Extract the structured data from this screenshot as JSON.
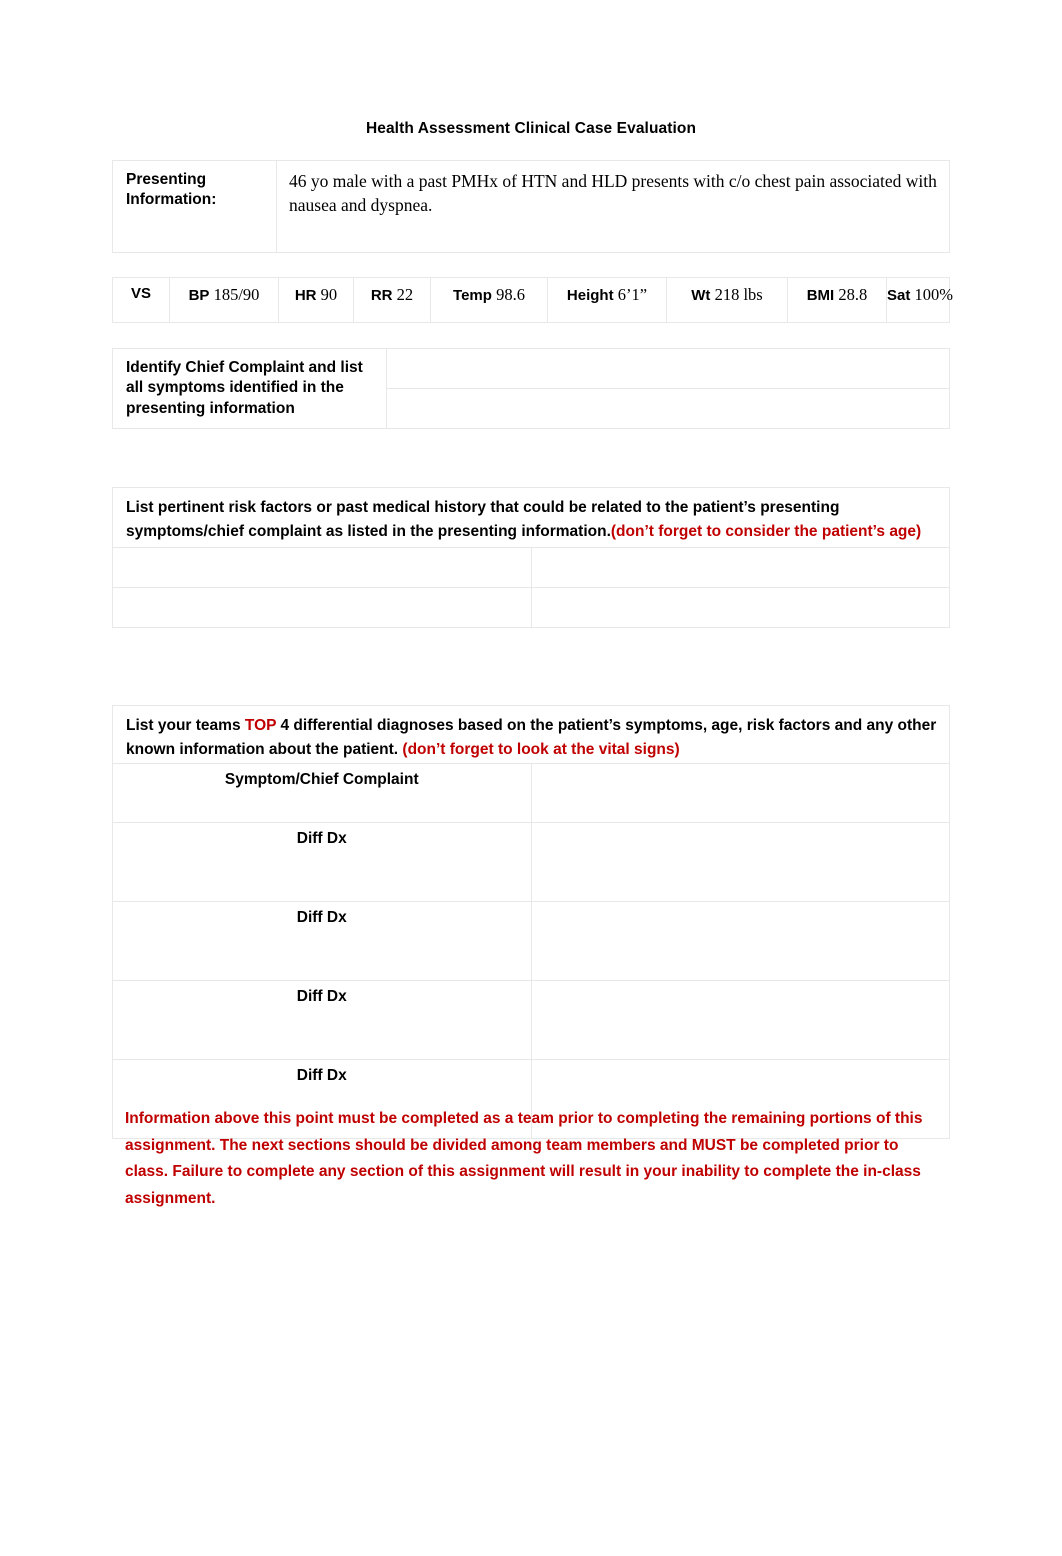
{
  "document": {
    "title": "Health Assessment Clinical Case Evaluation"
  },
  "presenting": {
    "label": "Presenting Information:",
    "text": "46 yo male with a past PMHx of HTN and HLD presents with c/o chest pain associated with nausea and dyspnea."
  },
  "vitals": {
    "heading": "VS",
    "items": [
      {
        "label": "BP",
        "value": "185/90"
      },
      {
        "label": "HR",
        "value": "90"
      },
      {
        "label": "RR",
        "value": "22"
      },
      {
        "label": "Temp",
        "value": "98.6"
      },
      {
        "label": "Height",
        "value": "6’1”"
      },
      {
        "label": "Wt",
        "value": "218 lbs"
      },
      {
        "label": "BMI",
        "value": "28.8"
      },
      {
        "label": "Sat",
        "value": "100%"
      }
    ]
  },
  "chief_complaint": {
    "label": "Identify Chief Complaint and list all symptoms identified in the presenting information",
    "answers": [
      "",
      ""
    ]
  },
  "risk_factors": {
    "prompt_black": "List pertinent risk factors or past medical history that could be related to the patient’s presenting symptoms/chief complaint as listed in the presenting information.",
    "prompt_red": "(don’t forget to consider the patient’s age)",
    "answers": [
      "",
      "",
      "",
      ""
    ]
  },
  "differential": {
    "prompt_part1": "List your teams ",
    "prompt_highlight": "TOP",
    "prompt_part2": " 4 differential diagnoses based on the patient’s symptoms, age, risk factors and any other known information about the patient. ",
    "prompt_red": "(don’t forget to look at the vital signs)",
    "rows": [
      {
        "label": "Symptom/Chief Complaint",
        "answer": ""
      },
      {
        "label": "Diff Dx",
        "answer": ""
      },
      {
        "label": "Diff Dx",
        "answer": ""
      },
      {
        "label": "Diff Dx",
        "answer": ""
      },
      {
        "label": "Diff Dx",
        "answer": ""
      }
    ]
  },
  "notice": {
    "text": "Information above this point must be completed as a team prior to completing the remaining portions of this assignment.  The next sections should be divided among team members and MUST be completed prior to class.  Failure to complete any section of this assignment will result in your inability to complete the in-class assignment."
  },
  "colors": {
    "accent_red": "#C00000",
    "border_gray": "#E8E8E8",
    "text_black": "#000000"
  }
}
